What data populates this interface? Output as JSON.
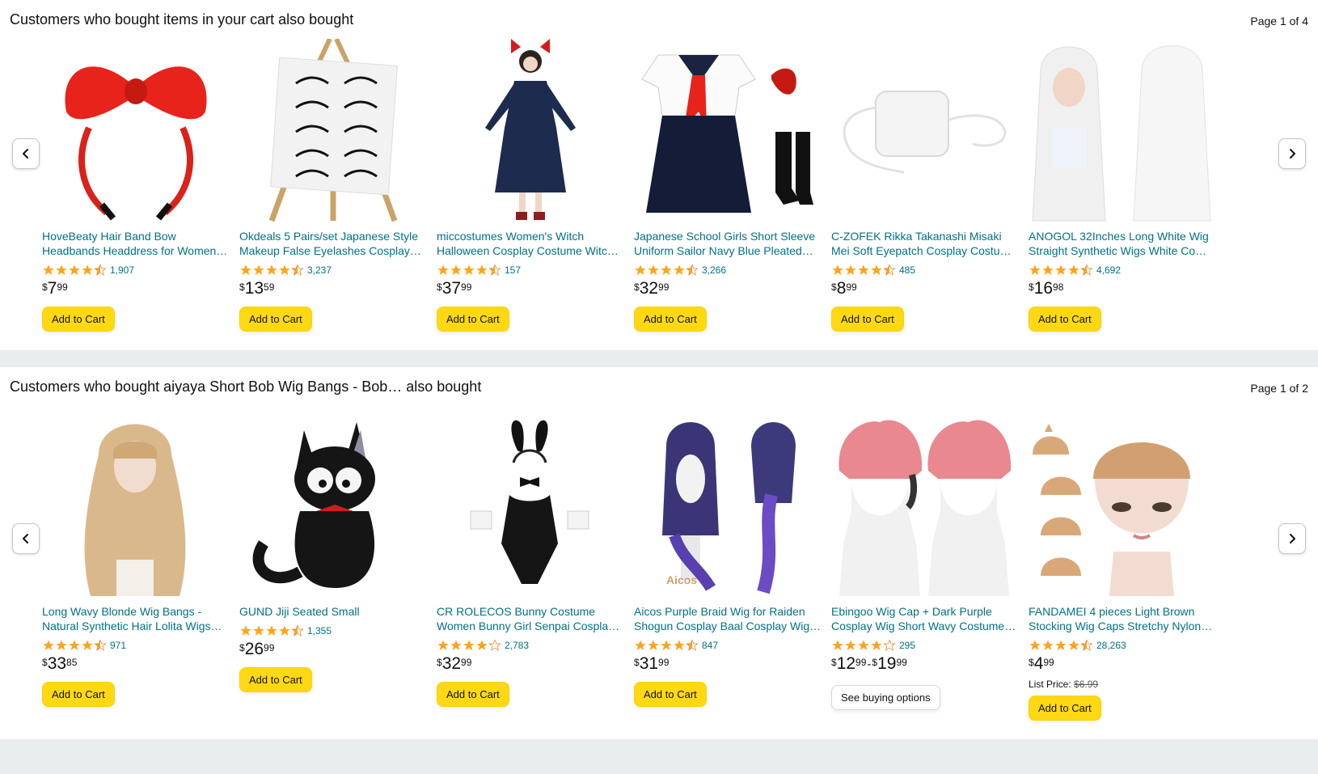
{
  "sections": [
    {
      "header": "Customers who bought items in your cart also bought",
      "page": "Page 1 of 4",
      "items": [
        {
          "title": "HoveBeaty Hair Band Bow Headbands Headdress for Women…",
          "rating": 4.5,
          "reviews": "1,907",
          "price_whole": "7",
          "price_frac": "99",
          "button": "Add to Cart"
        },
        {
          "title": "Okdeals 5 Pairs/set Japanese Style Makeup False Eyelashes Cosplay…",
          "rating": 4.5,
          "reviews": "3,237",
          "price_whole": "13",
          "price_frac": "59",
          "button": "Add to Cart"
        },
        {
          "title": "miccostumes Women's Witch Halloween Cosplay Costume Witc…",
          "rating": 4.5,
          "reviews": "157",
          "price_whole": "37",
          "price_frac": "99",
          "button": "Add to Cart"
        },
        {
          "title": "Japanese School Girls Short Sleeve Uniform Sailor Navy Blue Pleated…",
          "rating": 4.5,
          "reviews": "3,266",
          "price_whole": "32",
          "price_frac": "99",
          "button": "Add to Cart"
        },
        {
          "title": "C-ZOFEK Rikka Takanashi Misaki Mei Soft Eyepatch Cosplay Costu…",
          "rating": 4.5,
          "reviews": "485",
          "price_whole": "8",
          "price_frac": "99",
          "button": "Add to Cart"
        },
        {
          "title": "ANOGOL 32Inches Long White Wig Straight Synthetic Wigs White Co…",
          "rating": 4.5,
          "reviews": "4,692",
          "price_whole": "16",
          "price_frac": "98",
          "button": "Add to Cart"
        }
      ]
    },
    {
      "header": "Customers who bought aiyaya Short Bob Wig Bangs - Bob… also bought",
      "page": "Page 1 of 2",
      "items": [
        {
          "title": "Long Wavy Blonde Wig Bangs - Natural Synthetic Hair Lolita Wigs…",
          "rating": 4.5,
          "reviews": "971",
          "price_whole": "33",
          "price_frac": "85",
          "button": "Add to Cart"
        },
        {
          "title": "GUND Jiji Seated Small",
          "rating": 4.5,
          "reviews": "1,355",
          "price_whole": "26",
          "price_frac": "99",
          "button": "Add to Cart"
        },
        {
          "title": "CR ROLECOS Bunny Costume Women Bunny Girl Senpai Cospla…",
          "rating": 4,
          "reviews": "2,783",
          "price_whole": "32",
          "price_frac": "99",
          "button": "Add to Cart"
        },
        {
          "title": "Aicos Purple Braid Wig for Raiden Shogun Cosplay Baal Cosplay Wig…",
          "rating": 4.5,
          "reviews": "847",
          "price_whole": "31",
          "price_frac": "99",
          "button": "Add to Cart"
        },
        {
          "title": "Ebingoo Wig Cap + Dark Purple Cosplay Wig Short Wavy Costume…",
          "rating": 4,
          "reviews": "295",
          "price_whole": "12",
          "price_frac": "99",
          "price2_whole": "19",
          "price2_frac": "99",
          "button": "See buying options"
        },
        {
          "title": "FANDAMEI 4 pieces Light Brown Stocking Wig Caps Stretchy Nylon…",
          "rating": 4.5,
          "reviews": "28,263",
          "price_whole": "4",
          "price_frac": "99",
          "list_label": "List Price:",
          "list_price": "$6.99",
          "button": "Add to Cart"
        }
      ]
    }
  ],
  "currency": "$",
  "colors": {
    "star": "#ffa41c",
    "link": "#007185",
    "button": "#ffd814"
  }
}
